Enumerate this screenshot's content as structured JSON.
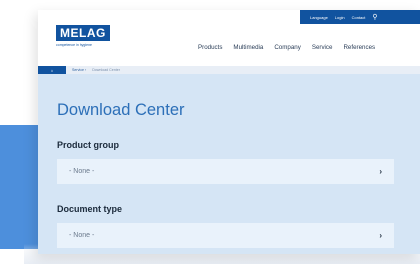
{
  "header": {
    "logo": {
      "brand": "MELAG",
      "tagline": "competence in hygiene"
    },
    "util_links": [
      "Language",
      "Login",
      "Contact"
    ],
    "main_nav": [
      "Products",
      "Multimedia",
      "Company",
      "Service",
      "References"
    ]
  },
  "breadcrumb": {
    "home_label": "⌂",
    "items": [
      "Service  ›",
      "Download Center"
    ]
  },
  "main": {
    "title": "Download Center",
    "product_group": {
      "label": "Product group",
      "value": "- None -"
    },
    "document_type": {
      "label": "Document type",
      "value": "- None -"
    }
  },
  "colors": {
    "brand_blue": "#11539f",
    "title_blue": "#2c6fb8",
    "content_bg": "#d5e5f5",
    "accent_panel": "#4d8fdc"
  }
}
